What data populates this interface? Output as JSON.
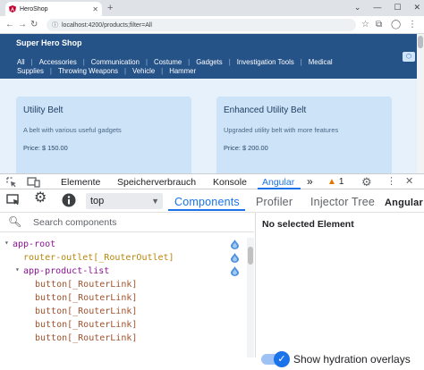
{
  "browser": {
    "tab_title": "HeroShop",
    "new_tab": "+",
    "url": "localhost:4200/products;filter=All",
    "window_controls": [
      "⌄",
      "—",
      "☐",
      "✕"
    ]
  },
  "site": {
    "brand": "Super Hero Shop",
    "nav_row1": [
      "All",
      "Accessories",
      "Communication",
      "Costume",
      "Gadgets",
      "Investigation Tools",
      "Medical"
    ],
    "nav_row2": [
      "Supplies",
      "Throwing Weapons",
      "Vehicle",
      "Hammer"
    ],
    "cards": [
      {
        "title": "Utility Belt",
        "description": "A belt with various useful gadgets",
        "price": "Price: $ 150.00"
      },
      {
        "title": "Enhanced Utility Belt",
        "description": "Upgraded utility belt with more features",
        "price": "Price: $ 200.00"
      }
    ]
  },
  "devtools": {
    "tabs": [
      "Elemente",
      "Speicherverbrauch",
      "Konsole",
      "Angular"
    ],
    "more": "»",
    "warning_count": "1",
    "angular": {
      "context": "top",
      "tabs": [
        "Components",
        "Profiler",
        "Injector Tree",
        "Angular v"
      ],
      "search_placeholder": "Search components",
      "tree": [
        "app-root",
        "router-outlet[_RouterOutlet]",
        "app-product-list",
        "button[_RouterLink]",
        "button[_RouterLink]",
        "button[_RouterLink]",
        "button[_RouterLink]",
        "button[_RouterLink]"
      ],
      "details_title": "No selected Element",
      "hydration_label": "Show hydration overlays"
    }
  },
  "colors": {
    "header_bg": "#255287",
    "page_bg": "#e7f1fb",
    "card_bg": "#cde3f8",
    "accent": "#1a73e8"
  }
}
